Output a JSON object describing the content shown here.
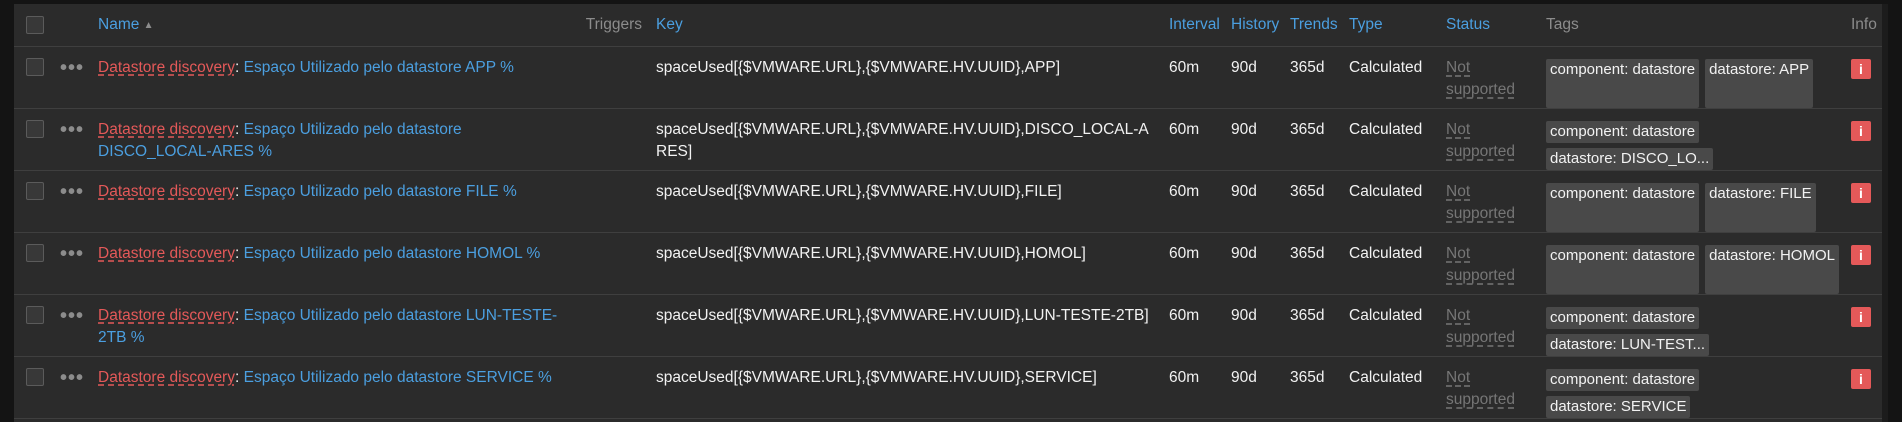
{
  "header": {
    "name": "Name",
    "sort_indicator": "▲",
    "triggers": "Triggers",
    "key": "Key",
    "interval": "Interval",
    "history": "History",
    "trends": "Trends",
    "type": "Type",
    "status": "Status",
    "tags": "Tags",
    "info": "Info"
  },
  "rows": [
    {
      "prefix": "Datastore discovery",
      "colon": ":",
      "name": "Espaço Utilizado pelo datastore APP %",
      "key": "spaceUsed[{$VMWARE.URL},{$VMWARE.HV.UUID},APP]",
      "interval": "60m",
      "history": "90d",
      "trends": "365d",
      "type": "Calculated",
      "status": "Not supported",
      "tags": [
        "component: datastore",
        "datastore: APP"
      ],
      "info": "i"
    },
    {
      "prefix": "Datastore discovery",
      "colon": ":",
      "name": "Espaço Utilizado pelo datastore DISCO_LOCAL-ARES %",
      "key": "spaceUsed[{$VMWARE.URL},{$VMWARE.HV.UUID},DISCO_LOCAL-ARES]",
      "interval": "60m",
      "history": "90d",
      "trends": "365d",
      "type": "Calculated",
      "status": "Not supported",
      "tags": [
        "component: datastore",
        "datastore: DISCO_LO..."
      ],
      "info": "i"
    },
    {
      "prefix": "Datastore discovery",
      "colon": ":",
      "name": "Espaço Utilizado pelo datastore FILE %",
      "key": "spaceUsed[{$VMWARE.URL},{$VMWARE.HV.UUID},FILE]",
      "interval": "60m",
      "history": "90d",
      "trends": "365d",
      "type": "Calculated",
      "status": "Not supported",
      "tags": [
        "component: datastore",
        "datastore: FILE"
      ],
      "info": "i"
    },
    {
      "prefix": "Datastore discovery",
      "colon": ":",
      "name": "Espaço Utilizado pelo datastore HOMOL %",
      "key": "spaceUsed[{$VMWARE.URL},{$VMWARE.HV.UUID},HOMOL]",
      "interval": "60m",
      "history": "90d",
      "trends": "365d",
      "type": "Calculated",
      "status": "Not supported",
      "tags": [
        "component: datastore",
        "datastore: HOMOL"
      ],
      "info": "i"
    },
    {
      "prefix": "Datastore discovery",
      "colon": ":",
      "name": "Espaço Utilizado pelo datastore LUN-TESTE-2TB %",
      "key": "spaceUsed[{$VMWARE.URL},{$VMWARE.HV.UUID},LUN-TESTE-2TB]",
      "interval": "60m",
      "history": "90d",
      "trends": "365d",
      "type": "Calculated",
      "status": "Not supported",
      "tags": [
        "component: datastore",
        "datastore: LUN-TEST..."
      ],
      "info": "i"
    },
    {
      "prefix": "Datastore discovery",
      "colon": ":",
      "name": "Espaço Utilizado pelo datastore SERVICE %",
      "key": "spaceUsed[{$VMWARE.URL},{$VMWARE.HV.UUID},SERVICE]",
      "interval": "60m",
      "history": "90d",
      "trends": "365d",
      "type": "Calculated",
      "status": "Not supported",
      "tags": [
        "component: datastore",
        "datastore: SERVICE"
      ],
      "info": "i"
    }
  ],
  "colors": {
    "link": "#4b9fe0",
    "prefix": "#e45959",
    "status_muted": "#767676",
    "info_bg": "#e45959",
    "tag_bg": "#494949"
  },
  "icons": {
    "row_menu": "more-dots-icon",
    "info": "info-icon"
  }
}
